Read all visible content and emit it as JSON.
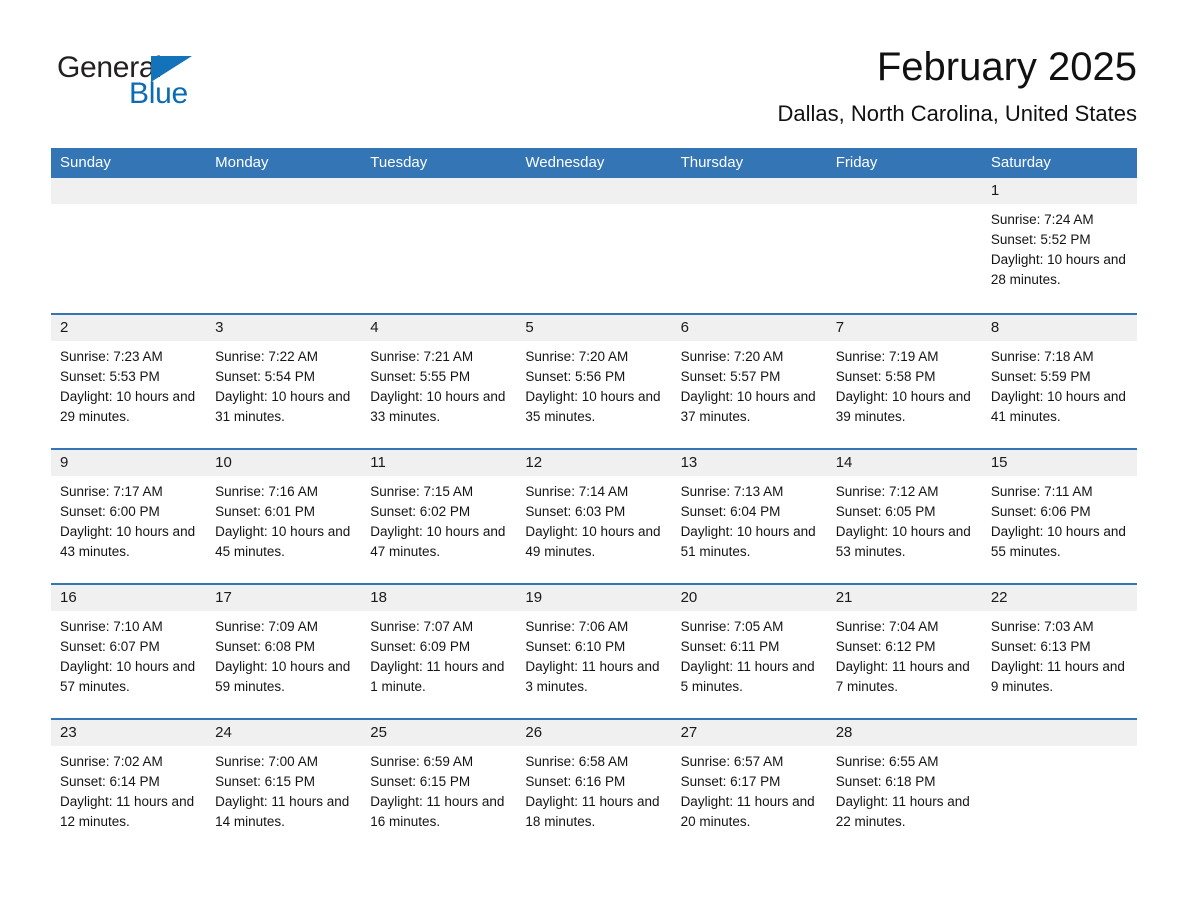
{
  "brand": {
    "name_dark": "General",
    "name_blue": "Blue",
    "accent_color": "#1272ba"
  },
  "header": {
    "title": "February 2025",
    "subtitle": "Dallas, North Carolina, United States",
    "header_bg": "#3375b5",
    "daynum_bg": "#f0f0f0"
  },
  "weekdays": [
    "Sunday",
    "Monday",
    "Tuesday",
    "Wednesday",
    "Thursday",
    "Friday",
    "Saturday"
  ],
  "labels": {
    "sunrise_prefix": "Sunrise:",
    "sunset_prefix": "Sunset:",
    "daylight_prefix": "Daylight:"
  },
  "weeks": [
    [
      {
        "day": "",
        "sunrise": "",
        "sunset": "",
        "daylight": "",
        "empty": true
      },
      {
        "day": "",
        "sunrise": "",
        "sunset": "",
        "daylight": "",
        "empty": true
      },
      {
        "day": "",
        "sunrise": "",
        "sunset": "",
        "daylight": "",
        "empty": true
      },
      {
        "day": "",
        "sunrise": "",
        "sunset": "",
        "daylight": "",
        "empty": true
      },
      {
        "day": "",
        "sunrise": "",
        "sunset": "",
        "daylight": "",
        "empty": true
      },
      {
        "day": "",
        "sunrise": "",
        "sunset": "",
        "daylight": "",
        "empty": true
      },
      {
        "day": "1",
        "sunrise": "Sunrise: 7:24 AM",
        "sunset": "Sunset: 5:52 PM",
        "daylight": "Daylight: 10 hours and 28 minutes."
      }
    ],
    [
      {
        "day": "2",
        "sunrise": "Sunrise: 7:23 AM",
        "sunset": "Sunset: 5:53 PM",
        "daylight": "Daylight: 10 hours and 29 minutes."
      },
      {
        "day": "3",
        "sunrise": "Sunrise: 7:22 AM",
        "sunset": "Sunset: 5:54 PM",
        "daylight": "Daylight: 10 hours and 31 minutes."
      },
      {
        "day": "4",
        "sunrise": "Sunrise: 7:21 AM",
        "sunset": "Sunset: 5:55 PM",
        "daylight": "Daylight: 10 hours and 33 minutes."
      },
      {
        "day": "5",
        "sunrise": "Sunrise: 7:20 AM",
        "sunset": "Sunset: 5:56 PM",
        "daylight": "Daylight: 10 hours and 35 minutes."
      },
      {
        "day": "6",
        "sunrise": "Sunrise: 7:20 AM",
        "sunset": "Sunset: 5:57 PM",
        "daylight": "Daylight: 10 hours and 37 minutes."
      },
      {
        "day": "7",
        "sunrise": "Sunrise: 7:19 AM",
        "sunset": "Sunset: 5:58 PM",
        "daylight": "Daylight: 10 hours and 39 minutes."
      },
      {
        "day": "8",
        "sunrise": "Sunrise: 7:18 AM",
        "sunset": "Sunset: 5:59 PM",
        "daylight": "Daylight: 10 hours and 41 minutes."
      }
    ],
    [
      {
        "day": "9",
        "sunrise": "Sunrise: 7:17 AM",
        "sunset": "Sunset: 6:00 PM",
        "daylight": "Daylight: 10 hours and 43 minutes."
      },
      {
        "day": "10",
        "sunrise": "Sunrise: 7:16 AM",
        "sunset": "Sunset: 6:01 PM",
        "daylight": "Daylight: 10 hours and 45 minutes."
      },
      {
        "day": "11",
        "sunrise": "Sunrise: 7:15 AM",
        "sunset": "Sunset: 6:02 PM",
        "daylight": "Daylight: 10 hours and 47 minutes."
      },
      {
        "day": "12",
        "sunrise": "Sunrise: 7:14 AM",
        "sunset": "Sunset: 6:03 PM",
        "daylight": "Daylight: 10 hours and 49 minutes."
      },
      {
        "day": "13",
        "sunrise": "Sunrise: 7:13 AM",
        "sunset": "Sunset: 6:04 PM",
        "daylight": "Daylight: 10 hours and 51 minutes."
      },
      {
        "day": "14",
        "sunrise": "Sunrise: 7:12 AM",
        "sunset": "Sunset: 6:05 PM",
        "daylight": "Daylight: 10 hours and 53 minutes."
      },
      {
        "day": "15",
        "sunrise": "Sunrise: 7:11 AM",
        "sunset": "Sunset: 6:06 PM",
        "daylight": "Daylight: 10 hours and 55 minutes."
      }
    ],
    [
      {
        "day": "16",
        "sunrise": "Sunrise: 7:10 AM",
        "sunset": "Sunset: 6:07 PM",
        "daylight": "Daylight: 10 hours and 57 minutes."
      },
      {
        "day": "17",
        "sunrise": "Sunrise: 7:09 AM",
        "sunset": "Sunset: 6:08 PM",
        "daylight": "Daylight: 10 hours and 59 minutes."
      },
      {
        "day": "18",
        "sunrise": "Sunrise: 7:07 AM",
        "sunset": "Sunset: 6:09 PM",
        "daylight": "Daylight: 11 hours and 1 minute."
      },
      {
        "day": "19",
        "sunrise": "Sunrise: 7:06 AM",
        "sunset": "Sunset: 6:10 PM",
        "daylight": "Daylight: 11 hours and 3 minutes."
      },
      {
        "day": "20",
        "sunrise": "Sunrise: 7:05 AM",
        "sunset": "Sunset: 6:11 PM",
        "daylight": "Daylight: 11 hours and 5 minutes."
      },
      {
        "day": "21",
        "sunrise": "Sunrise: 7:04 AM",
        "sunset": "Sunset: 6:12 PM",
        "daylight": "Daylight: 11 hours and 7 minutes."
      },
      {
        "day": "22",
        "sunrise": "Sunrise: 7:03 AM",
        "sunset": "Sunset: 6:13 PM",
        "daylight": "Daylight: 11 hours and 9 minutes."
      }
    ],
    [
      {
        "day": "23",
        "sunrise": "Sunrise: 7:02 AM",
        "sunset": "Sunset: 6:14 PM",
        "daylight": "Daylight: 11 hours and 12 minutes."
      },
      {
        "day": "24",
        "sunrise": "Sunrise: 7:00 AM",
        "sunset": "Sunset: 6:15 PM",
        "daylight": "Daylight: 11 hours and 14 minutes."
      },
      {
        "day": "25",
        "sunrise": "Sunrise: 6:59 AM",
        "sunset": "Sunset: 6:15 PM",
        "daylight": "Daylight: 11 hours and 16 minutes."
      },
      {
        "day": "26",
        "sunrise": "Sunrise: 6:58 AM",
        "sunset": "Sunset: 6:16 PM",
        "daylight": "Daylight: 11 hours and 18 minutes."
      },
      {
        "day": "27",
        "sunrise": "Sunrise: 6:57 AM",
        "sunset": "Sunset: 6:17 PM",
        "daylight": "Daylight: 11 hours and 20 minutes."
      },
      {
        "day": "28",
        "sunrise": "Sunrise: 6:55 AM",
        "sunset": "Sunset: 6:18 PM",
        "daylight": "Daylight: 11 hours and 22 minutes."
      },
      {
        "day": "",
        "sunrise": "",
        "sunset": "",
        "daylight": "",
        "empty": true
      }
    ]
  ]
}
